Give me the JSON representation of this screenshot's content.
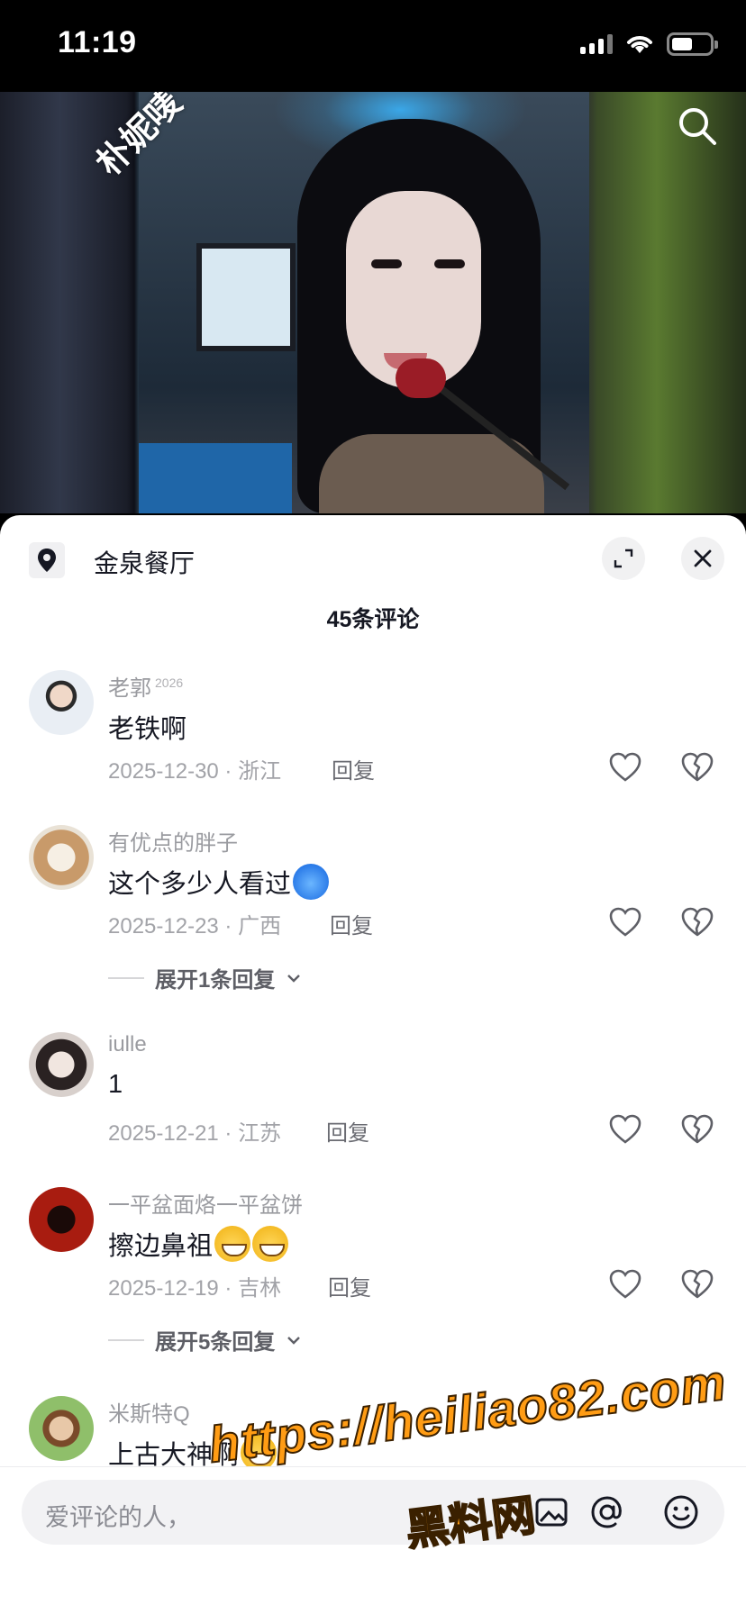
{
  "status_bar": {
    "time": "11:19"
  },
  "video": {
    "overlay_name": "朴妮唛"
  },
  "sheet": {
    "location": "金泉餐厅",
    "comment_count": "45条评论",
    "reply_label": "回复"
  },
  "comments": [
    {
      "user": "老郭",
      "badge": "2026",
      "text": "老铁啊",
      "meta": "2025-12-30 · 浙江"
    },
    {
      "user": "有优点的胖子",
      "text": "这个多少人看过",
      "meta": "2025-12-23 · 广西",
      "expand": "展开1条回复"
    },
    {
      "user": "iulle",
      "text": "1",
      "meta": "2025-12-21 · 江苏"
    },
    {
      "user": "一平盆面烙一平盆饼",
      "text": "擦边鼻祖",
      "meta": "2025-12-19 · 吉林",
      "expand": "展开5条回复"
    },
    {
      "user": "米斯特Q",
      "text": "上古大神啊"
    }
  ],
  "input": {
    "placeholder": "爱评论的人，"
  },
  "overlay_ad": {
    "url": "https://heiliao82.com",
    "name": "黑料网"
  },
  "colors": {
    "accent_ad": "#ff9c14",
    "text_primary": "#161823",
    "text_secondary": "#9a9ba0"
  }
}
